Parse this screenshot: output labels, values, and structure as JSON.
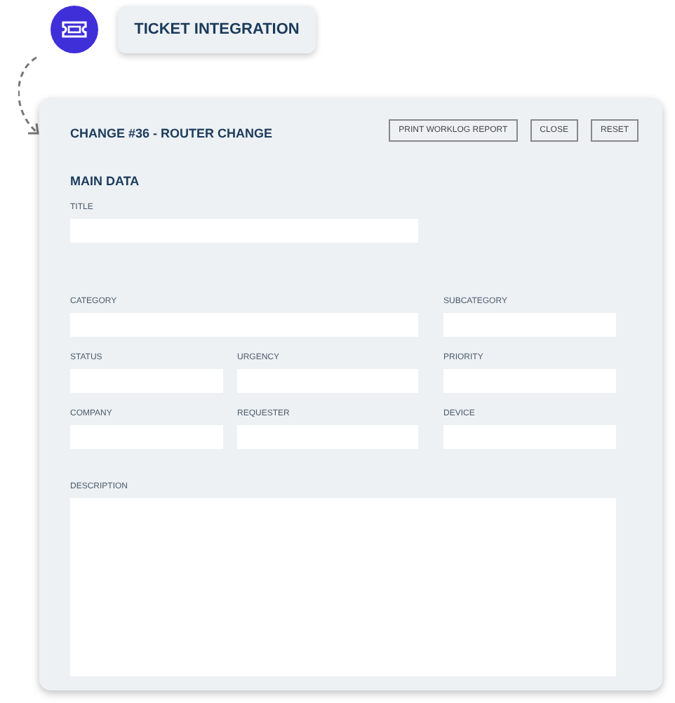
{
  "badge": {
    "label": "TICKET INTEGRATION"
  },
  "form": {
    "title": "CHANGE #36 - ROUTER CHANGE",
    "buttons": [
      "PRINT WORKLOG REPORT",
      "CLOSE",
      "RESET"
    ],
    "section": "MAIN DATA",
    "fields": [
      {
        "label": "TITLE",
        "kind": "wide"
      },
      {
        "label": "CATEGORY",
        "kind": "wide"
      },
      {
        "label": "SUBCATEGORY",
        "kind": "side"
      },
      {
        "label": "STATUS",
        "kind": "short"
      },
      {
        "label": "URGENCY",
        "kind": "short"
      },
      {
        "label": "PRIORITY",
        "kind": "side"
      },
      {
        "label": "COMPANY",
        "kind": "short"
      },
      {
        "label": "REQUESTER",
        "kind": "short"
      },
      {
        "label": "DEVICE",
        "kind": "side"
      },
      {
        "label": "DESCRIPTION",
        "kind": "area"
      }
    ]
  }
}
